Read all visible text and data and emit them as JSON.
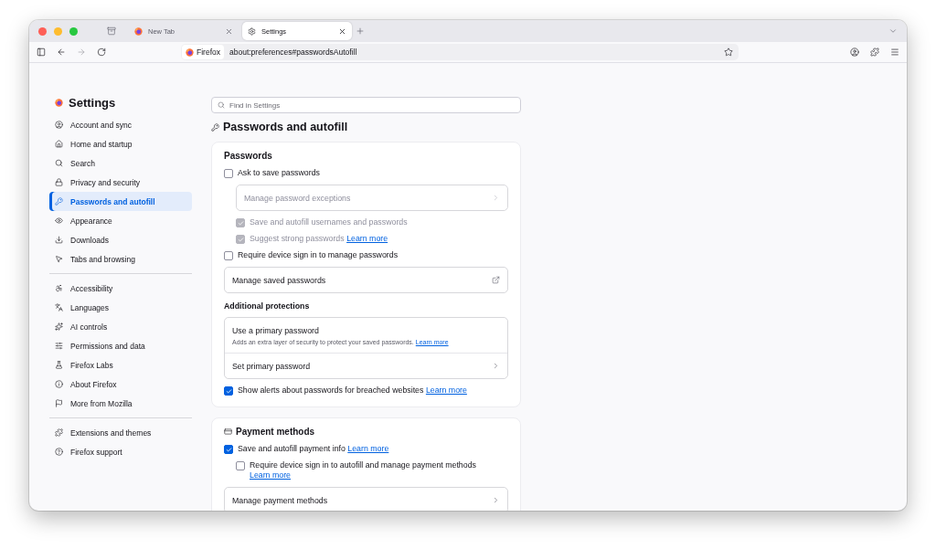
{
  "tabs": [
    {
      "label": "New Tab",
      "selected": false
    },
    {
      "label": "Settings",
      "selected": true
    }
  ],
  "url_bar": {
    "identity": "Firefox",
    "url": "about:preferences#passwordsAutofill"
  },
  "sidebar": {
    "title": "Settings",
    "groups": [
      [
        {
          "label": "Account and sync",
          "selected": false
        },
        {
          "label": "Home and startup",
          "selected": false
        },
        {
          "label": "Search",
          "selected": false
        },
        {
          "label": "Privacy and security",
          "selected": false
        },
        {
          "label": "Passwords and autofill",
          "selected": true
        },
        {
          "label": "Appearance",
          "selected": false
        },
        {
          "label": "Downloads",
          "selected": false
        },
        {
          "label": "Tabs and browsing",
          "selected": false
        }
      ],
      [
        {
          "label": "Accessibility",
          "selected": false
        },
        {
          "label": "Languages",
          "selected": false
        },
        {
          "label": "AI controls",
          "selected": false
        },
        {
          "label": "Permissions and data",
          "selected": false
        },
        {
          "label": "Firefox Labs",
          "selected": false
        },
        {
          "label": "About Firefox",
          "selected": false
        },
        {
          "label": "More from Mozilla",
          "selected": false
        }
      ],
      [
        {
          "label": "Extensions and themes",
          "selected": false
        },
        {
          "label": "Firefox support",
          "selected": false
        }
      ]
    ]
  },
  "search": {
    "placeholder": "Find in Settings"
  },
  "page_title": "Passwords and autofill",
  "cards": [
    {
      "kind": "plain",
      "heading": "Passwords",
      "items": [
        {
          "kind": "checkbox",
          "label": "Ask to save passwords",
          "checked": false,
          "disabled": false,
          "children": [
            {
              "kind": "nav",
              "label": "Manage password exceptions",
              "disabled": true
            },
            {
              "kind": "checkbox",
              "label": "Save and autofill usernames and passwords",
              "checked": true,
              "disabled": true
            },
            {
              "kind": "checkbox",
              "label": "Suggest strong passwords",
              "link": "Learn more",
              "checked": true,
              "disabled": true
            }
          ]
        },
        {
          "kind": "checkbox",
          "label": "Require device sign in to manage passwords",
          "checked": false,
          "disabled": false
        },
        {
          "kind": "external",
          "label": "Manage saved passwords",
          "disabled": false
        },
        {
          "kind": "subheading",
          "label": "Additional protections"
        },
        {
          "kind": "group",
          "title": "Use a primary password",
          "description": "Adds an extra layer of security to protect your saved passwords.",
          "link": "Learn more",
          "action": "Set primary password"
        },
        {
          "kind": "checkbox",
          "label": "Show alerts about passwords for breached websites",
          "link": "Learn more",
          "checked": true,
          "disabled": false
        }
      ]
    },
    {
      "kind": "payment",
      "heading": "Payment methods",
      "items": [
        {
          "kind": "checkbox",
          "label": "Save and autofill payment info",
          "link": "Learn more",
          "checked": true,
          "disabled": false,
          "children": [
            {
              "kind": "checkbox",
              "label": "Require device sign in to autofill and manage payment methods",
              "link": "Learn more",
              "checked": false,
              "disabled": false
            }
          ]
        },
        {
          "kind": "nav",
          "label": "Manage payment methods",
          "disabled": false
        }
      ]
    }
  ]
}
